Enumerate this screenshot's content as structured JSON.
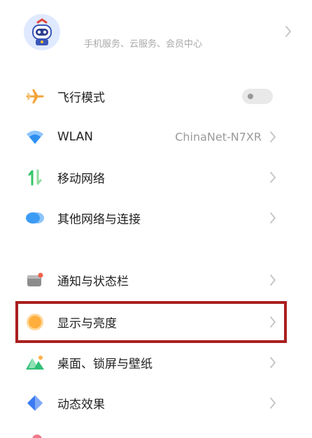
{
  "account": {
    "subtitle": "手机服务、云服务、会员中心",
    "avatar_icon": "robot-avatar-icon"
  },
  "section_network": {
    "items": [
      {
        "label": "飞行模式",
        "icon": "airplane-icon",
        "toggle_on": false
      },
      {
        "label": "WLAN",
        "icon": "wifi-icon",
        "value": "ChinaNet-N7XR"
      },
      {
        "label": "移动网络",
        "icon": "mobile-data-icon"
      },
      {
        "label": "其他网络与连接",
        "icon": "cloud-link-icon"
      }
    ]
  },
  "section_system": {
    "items": [
      {
        "label": "通知与状态栏",
        "icon": "notification-icon"
      },
      {
        "label": "显示与亮度",
        "icon": "brightness-icon",
        "highlighted": true
      },
      {
        "label": "桌面、锁屏与壁纸",
        "icon": "wallpaper-icon"
      },
      {
        "label": "动态效果",
        "icon": "motion-effect-icon"
      }
    ]
  },
  "colors": {
    "highlight_border": "#a91f1f",
    "airplane": "#f3a43a",
    "wifi": "#2f8ff0",
    "mobile": "#34c56a",
    "cloud": "#3c9bf5",
    "brightness": "#ffae3c",
    "wallpaper": "#2fbf76",
    "motion": "#3a7af2"
  }
}
